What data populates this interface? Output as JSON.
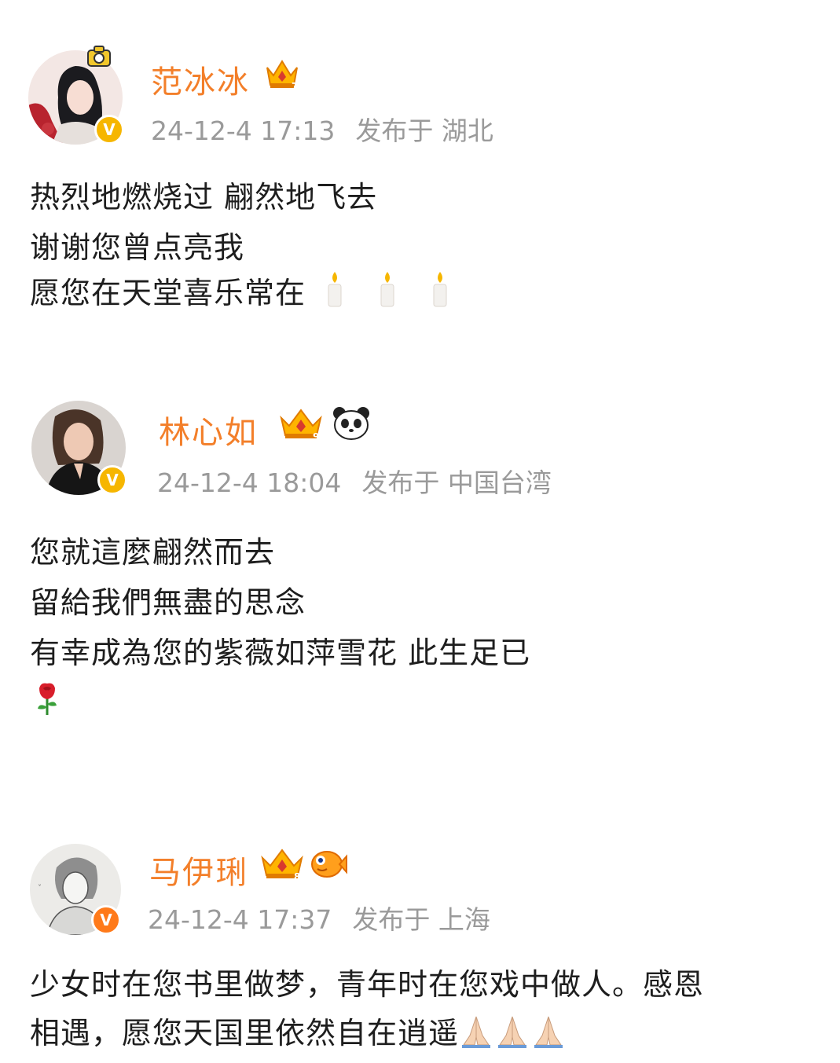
{
  "posts": [
    {
      "username": "范冰冰",
      "level": "7",
      "timestamp": "24-12-4 17:13",
      "published_label": "发布于",
      "location": "湖北",
      "lines": [
        "热烈地燃烧过  翩然地飞去",
        "谢谢您曾点亮我",
        "愿您在天堂喜乐常在"
      ],
      "emoji_after_last_line": [
        "candle-icon",
        "candle-icon",
        "candle-icon"
      ]
    },
    {
      "username": "林心如",
      "level": "9",
      "timestamp": "24-12-4 18:04",
      "published_label": "发布于",
      "location": "中国台湾",
      "extra_badge": "panda-icon",
      "lines": [
        "您就這麼翩然而去",
        "留給我們無盡的思念",
        "有幸成為您的紫薇如萍雪花  此生足已"
      ],
      "emoji_line": "rose-icon"
    },
    {
      "username": "马伊琍",
      "level": "8",
      "timestamp": "24-12-4 17:37",
      "published_label": "发布于",
      "location": "上海",
      "extra_badge": "fish-icon",
      "lines": [
        "少女时在您书里做梦，青年时在您戏中做人。感恩",
        "相遇，愿您天国里依然自在逍遥"
      ],
      "emoji_after_last_line": [
        "pray-icon",
        "pray-icon",
        "pray-icon"
      ]
    }
  ],
  "colors": {
    "username": "#f37f2a",
    "meta": "#9a9a9a",
    "body": "#1e1e1e",
    "verified_gold": "#f6b600",
    "verified_orange": "#ff7a1a"
  }
}
